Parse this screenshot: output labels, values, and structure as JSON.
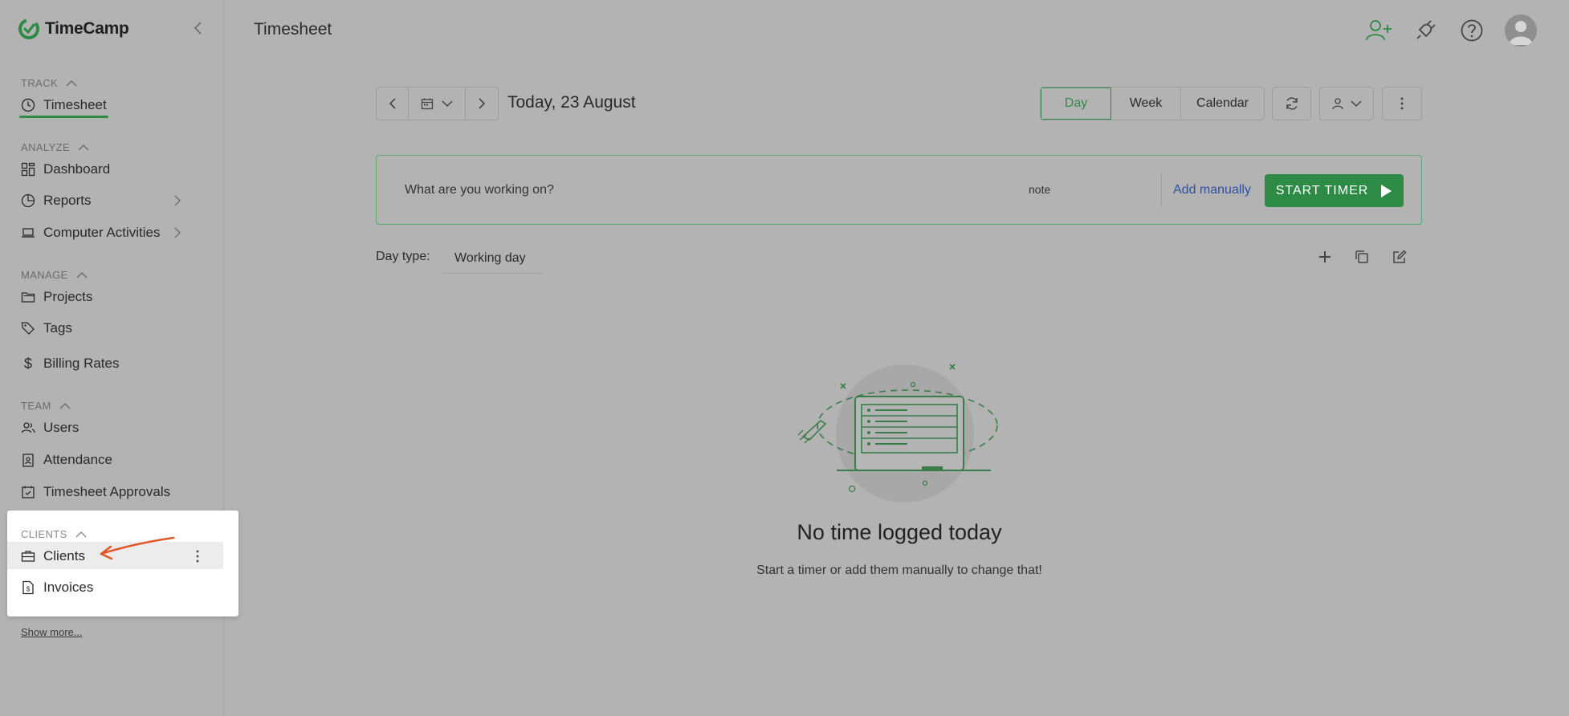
{
  "app": {
    "name": "TimeCamp"
  },
  "sidebar": {
    "sections": {
      "track": {
        "label": "TRACK",
        "items": [
          {
            "label": "Timesheet",
            "icon": "clock-icon"
          }
        ]
      },
      "analyze": {
        "label": "ANALYZE",
        "items": [
          {
            "label": "Dashboard",
            "icon": "dashboard-icon"
          },
          {
            "label": "Reports",
            "icon": "reports-icon"
          },
          {
            "label": "Computer Activities",
            "icon": "laptop-icon"
          }
        ]
      },
      "manage": {
        "label": "MANAGE",
        "items": [
          {
            "label": "Projects",
            "icon": "folder-icon"
          },
          {
            "label": "Tags",
            "icon": "tag-icon"
          },
          {
            "label": "Billing Rates",
            "icon": "dollar-icon"
          }
        ]
      },
      "team": {
        "label": "TEAM",
        "items": [
          {
            "label": "Users",
            "icon": "users-icon"
          },
          {
            "label": "Attendance",
            "icon": "attendance-icon"
          },
          {
            "label": "Timesheet Approvals",
            "icon": "calendar-check-icon"
          }
        ]
      },
      "clients": {
        "label": "CLIENTS",
        "items": [
          {
            "label": "Clients",
            "icon": "briefcase-icon"
          },
          {
            "label": "Invoices",
            "icon": "invoice-icon"
          }
        ]
      }
    },
    "show_more": "Show more..."
  },
  "header": {
    "title": "Timesheet"
  },
  "datenav": {
    "date_label": "Today, 23 August"
  },
  "views": {
    "day": "Day",
    "week": "Week",
    "calendar": "Calendar",
    "active": "Day"
  },
  "timer": {
    "placeholder": "What are you working on?",
    "note": "note",
    "add_manually": "Add manually",
    "start_label": "START TIMER"
  },
  "daytype": {
    "label": "Day type:",
    "value": "Working day"
  },
  "empty": {
    "title": "No time logged today",
    "subtitle": "Start a timer or add them manually to change that!"
  },
  "colors": {
    "accent": "#2e8b46",
    "link": "#2f4ea3",
    "annotation": "#e0582a"
  }
}
